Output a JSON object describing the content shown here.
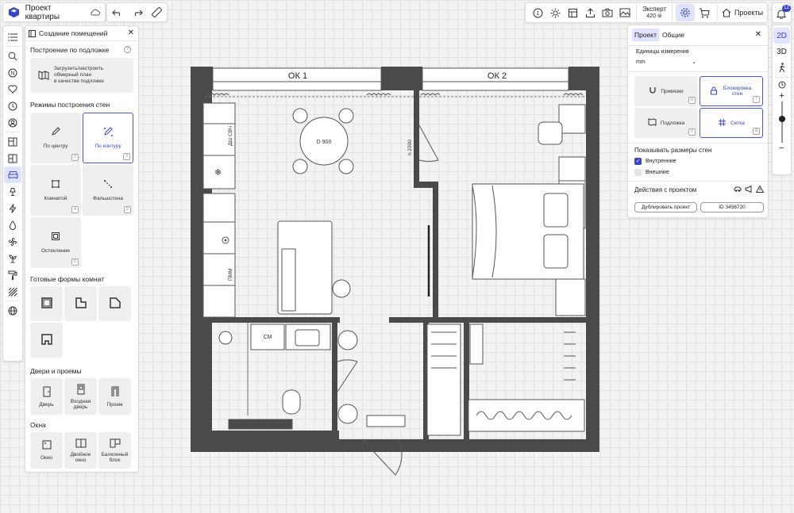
{
  "topbar": {
    "project_title": "Проект квартиры",
    "expert_label": "Эксперт",
    "expert_count": "420",
    "projects_label": "Проекты",
    "notif_count": "12"
  },
  "left_panel": {
    "title": "Создание помещений",
    "underlay_section": "Построение по подложке",
    "underlay_button": [
      "Загрузить/настроить",
      "обмерный план",
      "в качестве подложки"
    ],
    "wall_modes_section": "Режимы построения стен",
    "wall_modes": [
      {
        "label": "По центру",
        "key": "2"
      },
      {
        "label": "По контуру",
        "key": "3"
      },
      {
        "label": "Комнатой",
        "key": "4"
      },
      {
        "label": "Фальшстена",
        "key": "5"
      },
      {
        "label": "Остекление",
        "key": "6"
      }
    ],
    "room_shapes_section": "Готовые формы комнат",
    "doors_section": "Двери и проемы",
    "doors": [
      {
        "label": "Дверь"
      },
      {
        "label": "Входная дверь"
      },
      {
        "label": "Проем"
      }
    ],
    "windows_section": "Окна",
    "windows": [
      {
        "label": "Окно"
      },
      {
        "label": "Двойное окно"
      },
      {
        "label": "Балконный блок"
      }
    ]
  },
  "plan": {
    "window1": "ОК 1",
    "window2": "ОК 2",
    "table_label": "D 900",
    "door_height": "h 2300",
    "dsh_label": "ДШ",
    "svch_label": "СВЧ",
    "pmm_label": "ПММ",
    "sm_label": "СМ"
  },
  "settings_panel": {
    "tab_project": "Проект",
    "tab_general": "Общие",
    "units_label": "Единицы измерения",
    "units_value": "mm",
    "tools": [
      {
        "label": "Привязки",
        "key": "U"
      },
      {
        "label": "Блокировка стен",
        "key": "/"
      },
      {
        "label": "Подложка",
        "key": "Y"
      },
      {
        "label": "Сетка",
        "key": "G"
      }
    ],
    "wall_sizes_label": "Показывать размеры стен",
    "inner_label": "Внутренние",
    "outer_label": "Внешние",
    "actions_label": "Действия с проектом",
    "duplicate_label": "Дублировать проект",
    "id_label": "ID 3456720"
  },
  "view_bar": {
    "mode_2d": "2D",
    "mode_3d": "3D"
  },
  "colors": {
    "accent": "#3a45c7",
    "active_bg": "#dfe3ff",
    "wall": "#4a4a4a"
  }
}
